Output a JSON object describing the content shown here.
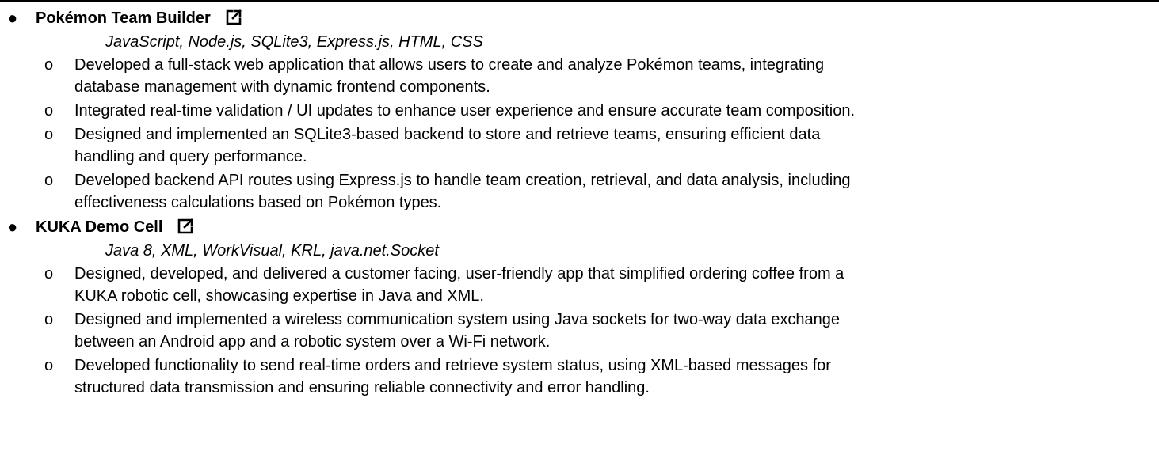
{
  "projects": [
    {
      "title": "Pokémon Team Builder",
      "link_icon": "external-link-icon",
      "tech": "JavaScript, Node.js, SQLite3, Express.js, HTML, CSS",
      "items": [
        "Developed a full-stack web application that allows users to create and analyze Pokémon teams, integrating\ndatabase management with dynamic frontend components.",
        "Integrated real-time validation / UI updates to enhance user experience and ensure accurate team composition.",
        "Designed and implemented an SQLite3-based backend to store and retrieve teams, ensuring efficient data\nhandling and query performance.",
        "Developed backend API routes using Express.js to handle team creation, retrieval, and data analysis, including\neffectiveness calculations based on Pokémon types."
      ]
    },
    {
      "title": "KUKA Demo Cell",
      "link_icon": "external-link-icon",
      "tech": "Java 8, XML, WorkVisual, KRL, java.net.Socket",
      "items": [
        "Designed, developed, and delivered a customer facing, user-friendly app that simplified ordering coffee from a\nKUKA robotic cell, showcasing expertise in Java and XML.",
        "Designed and implemented a wireless communication system using Java sockets for two-way data exchange\nbetween an Android app and a robotic system over a Wi-Fi network.",
        "Developed functionality to send real-time orders and retrieve system status, using XML-based messages for\nstructured data transmission and ensuring reliable connectivity and error handling."
      ]
    }
  ]
}
